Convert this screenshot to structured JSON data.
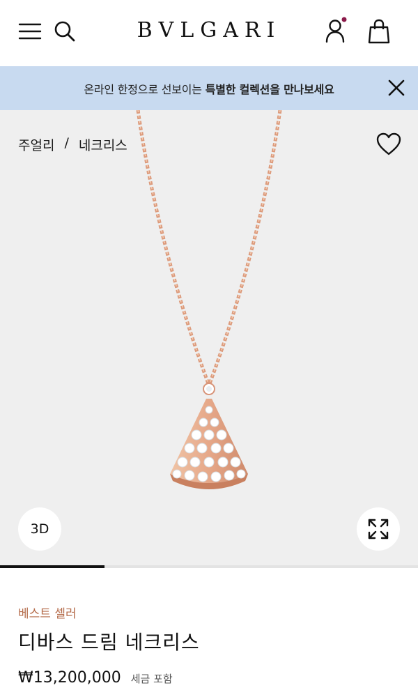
{
  "header": {
    "brand": "BVLGARI",
    "menu_icon": "hamburger-menu-icon",
    "search_icon": "search-icon",
    "account_icon": "user-icon",
    "bag_icon": "shopping-bag-icon",
    "notification_dot_color": "#8b1a4a"
  },
  "promo": {
    "text_regular": "온라인 한정으로 선보이는 ",
    "text_bold": "특별한 컬렉션을 만나보세요",
    "background": "#c8daf0",
    "close_icon": "close-icon"
  },
  "breadcrumb": {
    "items": [
      "주얼리",
      "네크리스"
    ],
    "separator": "/"
  },
  "gallery": {
    "background": "#efefef",
    "wishlist_icon": "heart-icon",
    "btn_3d_label": "3D",
    "fullscreen_icon": "expand-icon",
    "progress": 0.25
  },
  "product": {
    "label": "베스트 셀러",
    "name": "디바스 드림 네크리스",
    "price": "₩13,200,000",
    "tax_note": "세금 포함",
    "accent_color": "#b56c4b",
    "metal_color": "#e6a889"
  }
}
